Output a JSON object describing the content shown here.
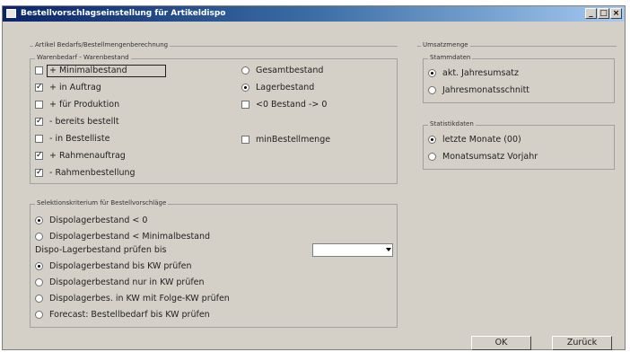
{
  "window": {
    "title": "Bestellvorschlagseinstellung für Artikeldispo",
    "minimize_label": "_",
    "maximize_label": "□",
    "close_label": "×"
  },
  "artikel_group": {
    "title": "Artikel Bedarfs/Bestellmengenberechnung"
  },
  "warenbedarf": {
    "title": "Warenbedarf - Warenbestand",
    "left_items": [
      {
        "label": "+ Minimalbestand",
        "checked": false
      },
      {
        "label": "+ in Auftrag",
        "checked": true
      },
      {
        "label": "+ für Produktion",
        "checked": false
      },
      {
        "label": "- bereits bestellt",
        "checked": true
      },
      {
        "label": "- in Bestelliste",
        "checked": false
      },
      {
        "label": "+ Rahmenauftrag",
        "checked": true
      },
      {
        "label": "- Rahmenbestellung",
        "checked": true
      }
    ],
    "right_radios": [
      {
        "label": "Gesamtbestand",
        "selected": false
      },
      {
        "label": "Lagerbestand",
        "selected": true
      }
    ],
    "right_checks": [
      {
        "label": "<0 Bestand -> 0",
        "checked": false
      },
      {
        "label": "minBestellmenge",
        "checked": false
      }
    ]
  },
  "selektion": {
    "title": "Selektionskriterium für Bestellvorschläge",
    "radios_top": [
      {
        "label": "Dispolagerbestand < 0",
        "selected": true
      },
      {
        "label": "Dispolagerbestand < Minimalbestand",
        "selected": false
      }
    ],
    "pruefen_label": "Dispo-Lagerbestand prüfen bis",
    "combo_value": "",
    "radios_bottom": [
      {
        "label": "Dispolagerbestand bis KW prüfen",
        "selected": true
      },
      {
        "label": "Dispolagerbestand nur in KW prüfen",
        "selected": false
      },
      {
        "label": "Dispolagerbes. in KW mit Folge-KW prüfen",
        "selected": false
      },
      {
        "label": "Forecast: Bestellbedarf bis KW prüfen",
        "selected": false
      }
    ]
  },
  "umsatzmenge": {
    "title": "Umsatzmenge"
  },
  "stammdaten": {
    "title": "Stammdaten",
    "radios": [
      {
        "label": "akt. Jahresumsatz",
        "selected": true
      },
      {
        "label": "Jahresmonatsschnitt",
        "selected": false
      }
    ]
  },
  "statistikdaten": {
    "title": "Statistikdaten",
    "radios": [
      {
        "label": "letzte Monate (00)",
        "selected": true
      },
      {
        "label": "Monatsumsatz Vorjahr",
        "selected": false
      }
    ]
  },
  "buttons": {
    "ok_label": "OK",
    "back_label": "Zurück"
  }
}
